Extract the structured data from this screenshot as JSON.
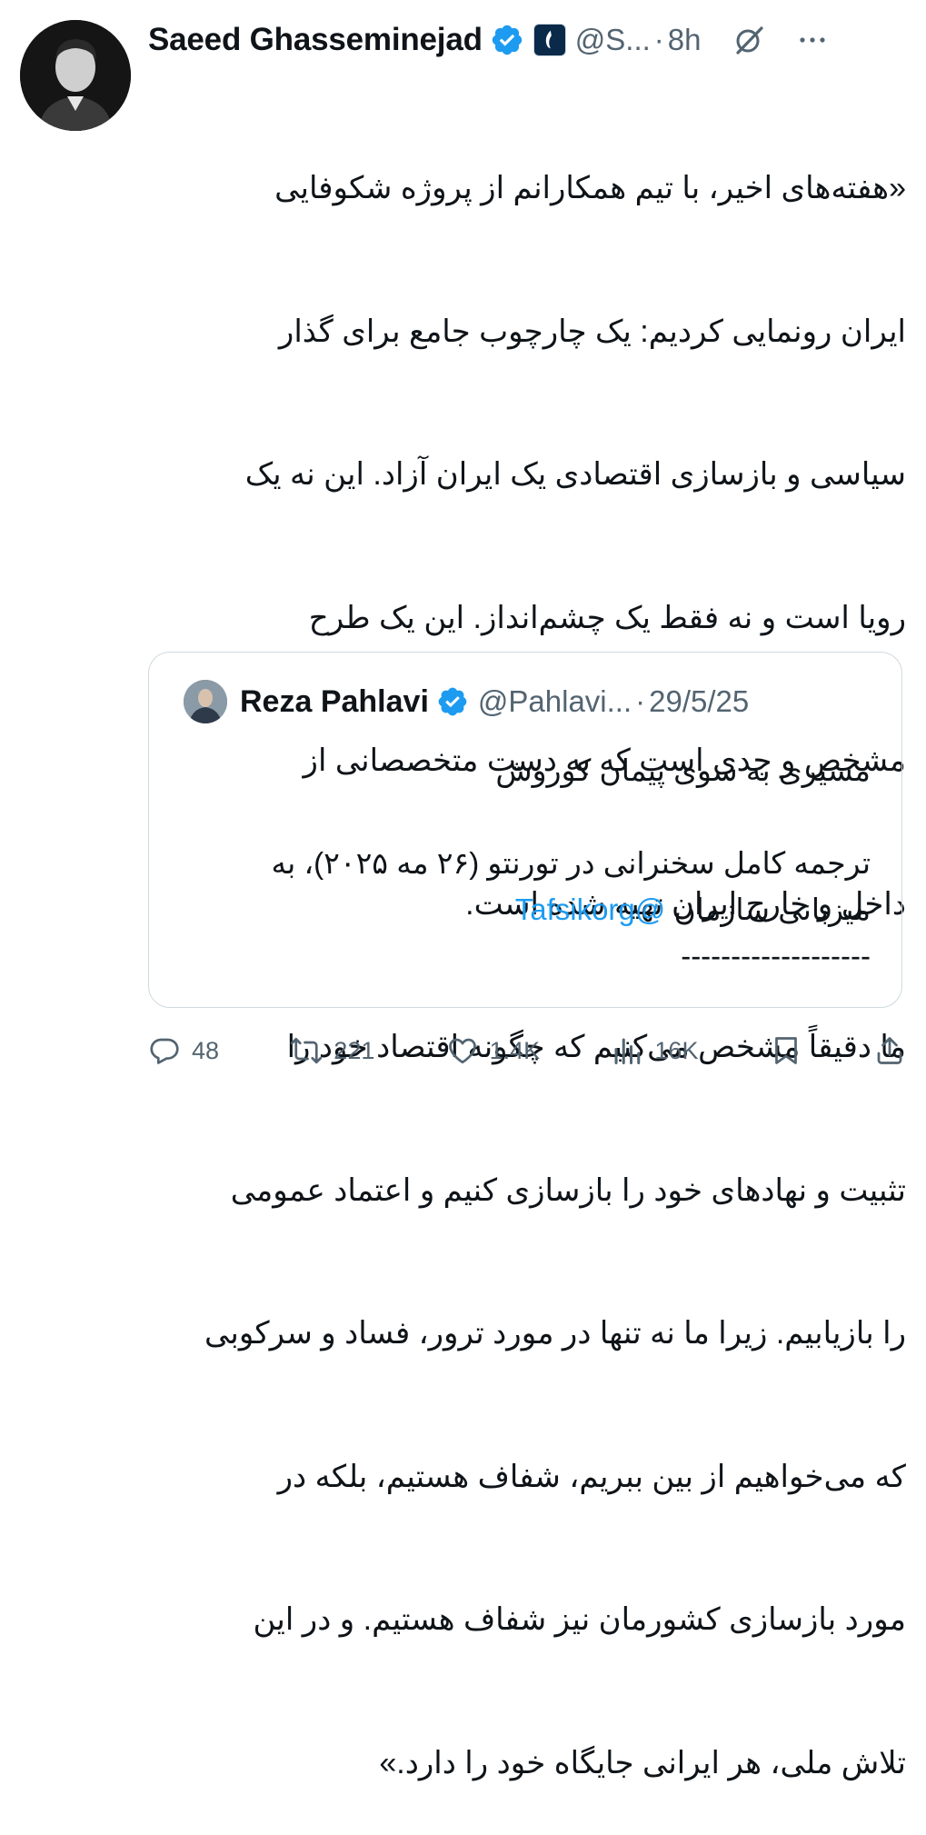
{
  "author": {
    "name": "Saeed Ghasseminejad",
    "handle": "@S...",
    "separator": "·",
    "time": "8h"
  },
  "post": {
    "lines": [
      "«هفته‌های اخیر، با تیم همکارانم از پروژه شکوفایی",
      "ایران رونمایی کردیم: یک چارچوب جامع برای گذار",
      "سیاسی و بازسازی اقتصادی یک ایران آزاد. این نه یک",
      "رویا است و نه فقط یک چشم‌انداز. این یک طرح",
      "مشخص و جدی است که به دست متخصصانی از",
      "داخل و خارج ایران تهیه شده است.",
      "ما دقیقاً مشخص می‌کنیم که چگونه اقتصاد خود را",
      "تثبیت و نهادهای خود را بازسازی کنیم و اعتماد عمومی",
      "را بازیابیم. زیرا ما نه تنها در مورد ترور، فساد و سرکوبی",
      "که می‌خواهیم از بین ببریم، شفاف هستیم، بلکه در",
      "مورد بازسازی کشورمان نیز شفاف هستیم. و در این",
      "تلاش ملی، هر ایرانی جایگاه خود را دارد.»"
    ]
  },
  "quoted": {
    "name": "Reza Pahlavi",
    "handle": "@Pahlavi...",
    "separator": "·",
    "date": "29/5/25",
    "line1": "مسیری به سوی پیمان کوروش",
    "line2": "ترجمه کامل سخنرانی در تورنتو (۲۶ مه ۲۰۲۵)، به",
    "line3_text": "میزبانی سازمان ",
    "line3_mention": "@Tafsikorg",
    "line4": "-------------------"
  },
  "actions": {
    "replies": "48",
    "reposts": "221",
    "likes": "1.4K",
    "views": "16K"
  },
  "colors": {
    "verified": "#1d9bf0",
    "muted": "#536471",
    "border": "#cfd9de"
  },
  "icons": [
    "verified-badge-icon",
    "affiliate-badge-icon",
    "grok-icon",
    "more-icon",
    "reply-icon",
    "repost-icon",
    "like-icon",
    "views-icon",
    "bookmark-icon",
    "share-icon"
  ]
}
